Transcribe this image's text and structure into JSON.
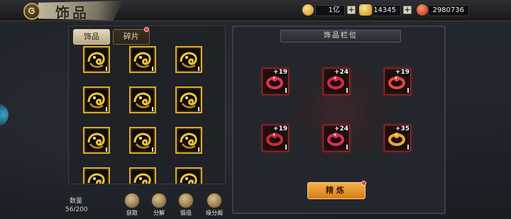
{
  "header": {
    "title": "饰品",
    "currencies": [
      {
        "name": "gold-coin-icon",
        "value": "1亿",
        "color": "#f2c13a"
      },
      {
        "name": "gold-ingot-icon",
        "value": "14345",
        "color": "#f2c13a"
      },
      {
        "name": "red-gem-icon",
        "value": "2980736",
        "color": "#e2452e"
      }
    ]
  },
  "left_panel": {
    "tabs": [
      {
        "label": "饰品",
        "active": true
      },
      {
        "label": "碎片",
        "active": false,
        "has_notification": true
      }
    ],
    "items_visible": 12,
    "count_label": "数量",
    "count_value": "56/200",
    "actions": [
      {
        "label": "获取",
        "icon": "hand-icon"
      },
      {
        "label": "分解",
        "icon": "swirl-icon"
      },
      {
        "label": "锻造",
        "icon": "hammer-icon"
      },
      {
        "label": "缘分阁",
        "icon": "pavilion-icon"
      }
    ]
  },
  "right_panel": {
    "header": "饰品栏位",
    "slots": [
      {
        "level": "+19",
        "icon": "red-ring-icon"
      },
      {
        "level": "+24",
        "icon": "red-amulet-icon"
      },
      {
        "level": "+19",
        "icon": "red-bracelet-icon"
      },
      {
        "level": "+19",
        "icon": "red-chain-ring-icon"
      },
      {
        "level": "+24",
        "icon": "red-pendant-icon"
      },
      {
        "level": "+35",
        "icon": "gold-ring-icon"
      }
    ],
    "refine_button": "精炼",
    "refine_has_notification": true
  },
  "colors": {
    "gold_border": "#d9a82a",
    "red_border": "#9b2b2b",
    "refine_button": "#e8901f"
  }
}
